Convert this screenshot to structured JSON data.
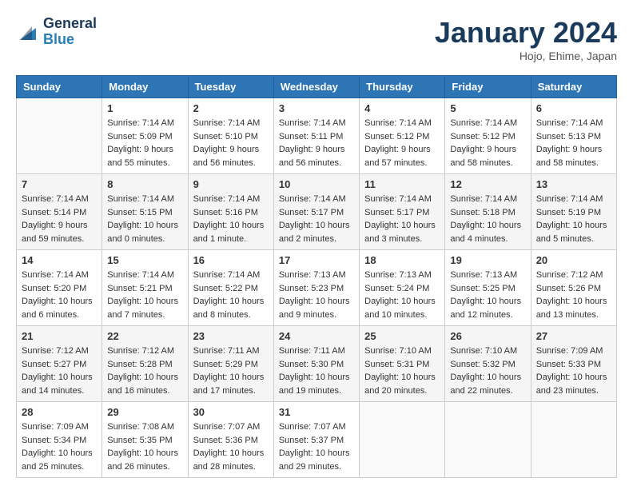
{
  "header": {
    "logo_general": "General",
    "logo_blue": "Blue",
    "month_title": "January 2024",
    "location": "Hojo, Ehime, Japan"
  },
  "weekdays": [
    "Sunday",
    "Monday",
    "Tuesday",
    "Wednesday",
    "Thursday",
    "Friday",
    "Saturday"
  ],
  "weeks": [
    [
      {
        "day": "",
        "sunrise": "",
        "sunset": "",
        "daylight": ""
      },
      {
        "day": "1",
        "sunrise": "Sunrise: 7:14 AM",
        "sunset": "Sunset: 5:09 PM",
        "daylight": "Daylight: 9 hours and 55 minutes."
      },
      {
        "day": "2",
        "sunrise": "Sunrise: 7:14 AM",
        "sunset": "Sunset: 5:10 PM",
        "daylight": "Daylight: 9 hours and 56 minutes."
      },
      {
        "day": "3",
        "sunrise": "Sunrise: 7:14 AM",
        "sunset": "Sunset: 5:11 PM",
        "daylight": "Daylight: 9 hours and 56 minutes."
      },
      {
        "day": "4",
        "sunrise": "Sunrise: 7:14 AM",
        "sunset": "Sunset: 5:12 PM",
        "daylight": "Daylight: 9 hours and 57 minutes."
      },
      {
        "day": "5",
        "sunrise": "Sunrise: 7:14 AM",
        "sunset": "Sunset: 5:12 PM",
        "daylight": "Daylight: 9 hours and 58 minutes."
      },
      {
        "day": "6",
        "sunrise": "Sunrise: 7:14 AM",
        "sunset": "Sunset: 5:13 PM",
        "daylight": "Daylight: 9 hours and 58 minutes."
      }
    ],
    [
      {
        "day": "7",
        "sunrise": "Sunrise: 7:14 AM",
        "sunset": "Sunset: 5:14 PM",
        "daylight": "Daylight: 9 hours and 59 minutes."
      },
      {
        "day": "8",
        "sunrise": "Sunrise: 7:14 AM",
        "sunset": "Sunset: 5:15 PM",
        "daylight": "Daylight: 10 hours and 0 minutes."
      },
      {
        "day": "9",
        "sunrise": "Sunrise: 7:14 AM",
        "sunset": "Sunset: 5:16 PM",
        "daylight": "Daylight: 10 hours and 1 minute."
      },
      {
        "day": "10",
        "sunrise": "Sunrise: 7:14 AM",
        "sunset": "Sunset: 5:17 PM",
        "daylight": "Daylight: 10 hours and 2 minutes."
      },
      {
        "day": "11",
        "sunrise": "Sunrise: 7:14 AM",
        "sunset": "Sunset: 5:17 PM",
        "daylight": "Daylight: 10 hours and 3 minutes."
      },
      {
        "day": "12",
        "sunrise": "Sunrise: 7:14 AM",
        "sunset": "Sunset: 5:18 PM",
        "daylight": "Daylight: 10 hours and 4 minutes."
      },
      {
        "day": "13",
        "sunrise": "Sunrise: 7:14 AM",
        "sunset": "Sunset: 5:19 PM",
        "daylight": "Daylight: 10 hours and 5 minutes."
      }
    ],
    [
      {
        "day": "14",
        "sunrise": "Sunrise: 7:14 AM",
        "sunset": "Sunset: 5:20 PM",
        "daylight": "Daylight: 10 hours and 6 minutes."
      },
      {
        "day": "15",
        "sunrise": "Sunrise: 7:14 AM",
        "sunset": "Sunset: 5:21 PM",
        "daylight": "Daylight: 10 hours and 7 minutes."
      },
      {
        "day": "16",
        "sunrise": "Sunrise: 7:14 AM",
        "sunset": "Sunset: 5:22 PM",
        "daylight": "Daylight: 10 hours and 8 minutes."
      },
      {
        "day": "17",
        "sunrise": "Sunrise: 7:13 AM",
        "sunset": "Sunset: 5:23 PM",
        "daylight": "Daylight: 10 hours and 9 minutes."
      },
      {
        "day": "18",
        "sunrise": "Sunrise: 7:13 AM",
        "sunset": "Sunset: 5:24 PM",
        "daylight": "Daylight: 10 hours and 10 minutes."
      },
      {
        "day": "19",
        "sunrise": "Sunrise: 7:13 AM",
        "sunset": "Sunset: 5:25 PM",
        "daylight": "Daylight: 10 hours and 12 minutes."
      },
      {
        "day": "20",
        "sunrise": "Sunrise: 7:12 AM",
        "sunset": "Sunset: 5:26 PM",
        "daylight": "Daylight: 10 hours and 13 minutes."
      }
    ],
    [
      {
        "day": "21",
        "sunrise": "Sunrise: 7:12 AM",
        "sunset": "Sunset: 5:27 PM",
        "daylight": "Daylight: 10 hours and 14 minutes."
      },
      {
        "day": "22",
        "sunrise": "Sunrise: 7:12 AM",
        "sunset": "Sunset: 5:28 PM",
        "daylight": "Daylight: 10 hours and 16 minutes."
      },
      {
        "day": "23",
        "sunrise": "Sunrise: 7:11 AM",
        "sunset": "Sunset: 5:29 PM",
        "daylight": "Daylight: 10 hours and 17 minutes."
      },
      {
        "day": "24",
        "sunrise": "Sunrise: 7:11 AM",
        "sunset": "Sunset: 5:30 PM",
        "daylight": "Daylight: 10 hours and 19 minutes."
      },
      {
        "day": "25",
        "sunrise": "Sunrise: 7:10 AM",
        "sunset": "Sunset: 5:31 PM",
        "daylight": "Daylight: 10 hours and 20 minutes."
      },
      {
        "day": "26",
        "sunrise": "Sunrise: 7:10 AM",
        "sunset": "Sunset: 5:32 PM",
        "daylight": "Daylight: 10 hours and 22 minutes."
      },
      {
        "day": "27",
        "sunrise": "Sunrise: 7:09 AM",
        "sunset": "Sunset: 5:33 PM",
        "daylight": "Daylight: 10 hours and 23 minutes."
      }
    ],
    [
      {
        "day": "28",
        "sunrise": "Sunrise: 7:09 AM",
        "sunset": "Sunset: 5:34 PM",
        "daylight": "Daylight: 10 hours and 25 minutes."
      },
      {
        "day": "29",
        "sunrise": "Sunrise: 7:08 AM",
        "sunset": "Sunset: 5:35 PM",
        "daylight": "Daylight: 10 hours and 26 minutes."
      },
      {
        "day": "30",
        "sunrise": "Sunrise: 7:07 AM",
        "sunset": "Sunset: 5:36 PM",
        "daylight": "Daylight: 10 hours and 28 minutes."
      },
      {
        "day": "31",
        "sunrise": "Sunrise: 7:07 AM",
        "sunset": "Sunset: 5:37 PM",
        "daylight": "Daylight: 10 hours and 29 minutes."
      },
      {
        "day": "",
        "sunrise": "",
        "sunset": "",
        "daylight": ""
      },
      {
        "day": "",
        "sunrise": "",
        "sunset": "",
        "daylight": ""
      },
      {
        "day": "",
        "sunrise": "",
        "sunset": "",
        "daylight": ""
      }
    ]
  ]
}
